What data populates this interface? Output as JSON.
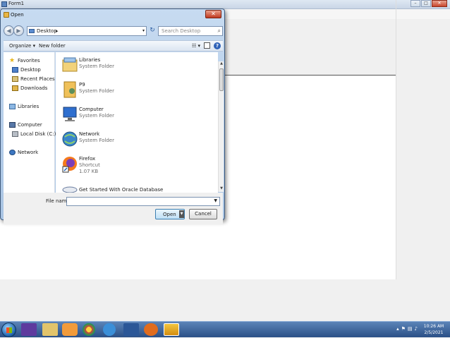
{
  "background_window": {
    "title": "Form1"
  },
  "dialog": {
    "title": "Open",
    "close_glyph": "✕",
    "nav": {
      "back_glyph": "◀",
      "forward_glyph": "▶",
      "refresh_glyph": "↻"
    },
    "address": {
      "location": "Desktop",
      "separator": "▸",
      "dropdown_glyph": "▾"
    },
    "search": {
      "placeholder": "Search Desktop",
      "icon": "search-icon"
    },
    "toolbar": {
      "organize_label": "Organize ▾",
      "new_folder_label": "New folder",
      "views_glyph": "☷ ▾",
      "help_glyph": "?"
    },
    "nav_pane": {
      "favorites": "Favorites",
      "desktop": "Desktop",
      "recent_places": "Recent Places",
      "downloads": "Downloads",
      "libraries": "Libraries",
      "computer": "Computer",
      "local_disk": "Local Disk (C:)",
      "network": "Network"
    },
    "files": [
      {
        "name": "Libraries",
        "type": "System Folder",
        "icon": "libraries-icon"
      },
      {
        "name": "P9",
        "type": "System Folder",
        "icon": "user-folder-icon"
      },
      {
        "name": "Computer",
        "type": "System Folder",
        "icon": "computer-icon"
      },
      {
        "name": "Network",
        "type": "System Folder",
        "icon": "network-icon"
      },
      {
        "name": "Firefox",
        "type": "Shortcut",
        "size": "1.07 KB",
        "icon": "firefox-icon"
      },
      {
        "name": "Get Started With Oracle Database",
        "icon": "oracle-icon"
      }
    ],
    "file_name_label": "File name:",
    "file_name_value": "",
    "open_label": "Open",
    "cancel_label": "Cancel"
  },
  "taskbar": {
    "time": "10:26 AM",
    "date": "2/5/2021"
  },
  "colors": {
    "dialog_frame": "#a9c4e3",
    "taskbar": "#2a4f86",
    "close_button": "#c0391f"
  }
}
